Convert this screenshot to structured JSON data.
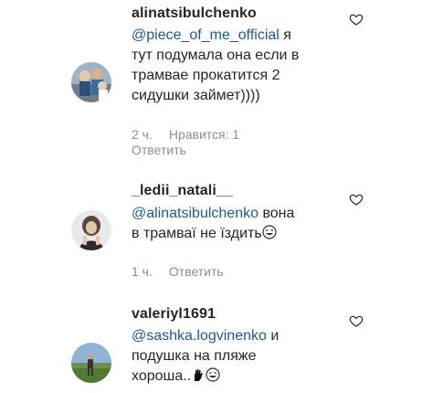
{
  "comments": [
    {
      "username": "alinatsibulchenko",
      "mention": "@piece_of_me_official",
      "text_line1_rest": " я",
      "text_line2": "тут подумала она если в",
      "text_line3": "трамвае прокатится 2",
      "text_line4": "сидушки займет))))",
      "time": "2 ч.",
      "likes": "Нравится: 1",
      "reply_label": "Ответить",
      "avatar_icon": "avatar-photo-icon",
      "like_icon": "heart-outline-icon"
    },
    {
      "username": "_ledii_natali__",
      "mention": "@alinatsibulchenko",
      "text_line1_rest": " вона",
      "text_line2": "в трамваї не їздить",
      "time": "1 ч.",
      "reply_label": "Ответить",
      "avatar_icon": "avatar-photo-icon",
      "like_icon": "heart-outline-icon"
    },
    {
      "username": "valeriyl1691",
      "mention": "@sashka.logvinenko",
      "text_line1_rest": " и",
      "text_line2": "подушка на пляже",
      "text_line3": "хороша..",
      "avatar_icon": "avatar-photo-icon",
      "like_icon": "heart-outline-icon"
    }
  ],
  "colors": {
    "text": "#262626",
    "mention": "#1f5b93",
    "meta": "#8e8e8e"
  }
}
